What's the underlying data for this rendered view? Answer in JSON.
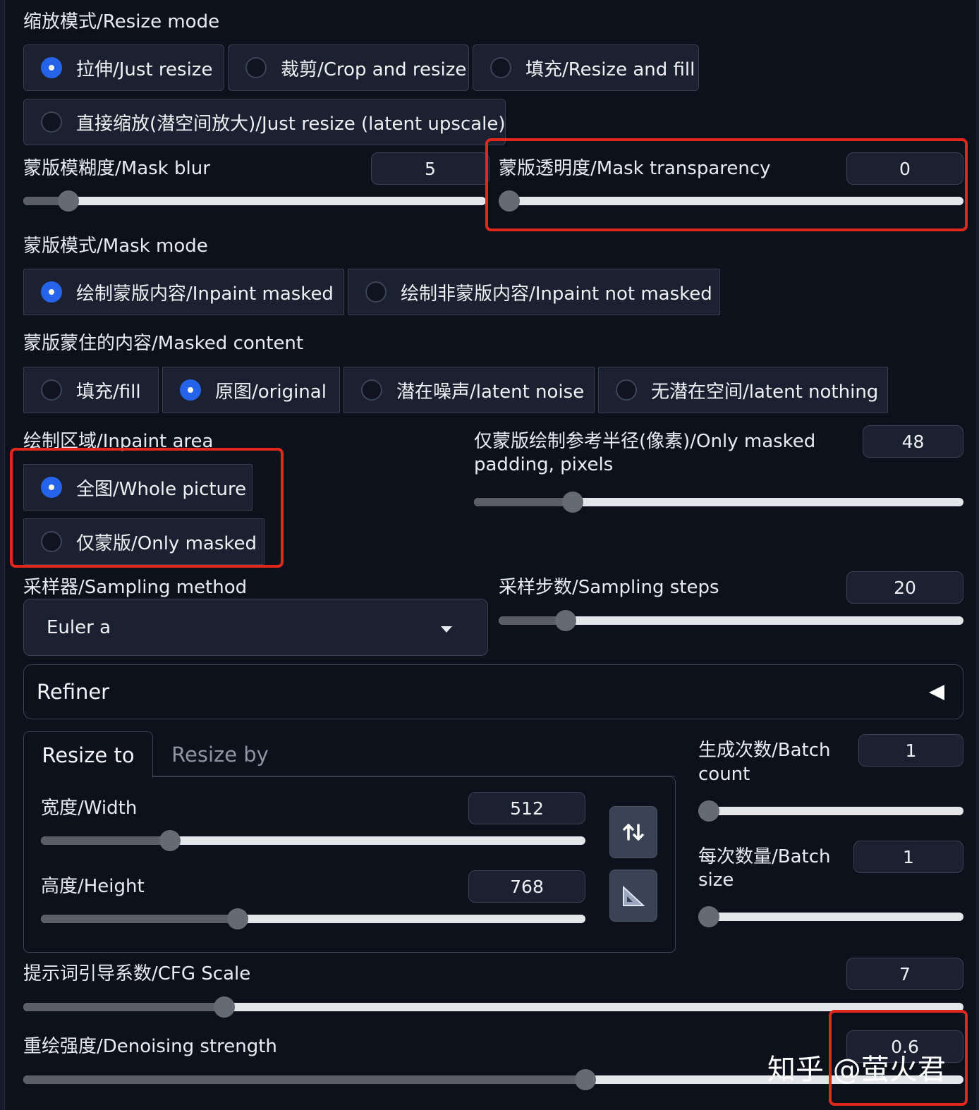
{
  "resize_mode": {
    "label": "缩放模式/Resize mode",
    "options": [
      "拉伸/Just resize",
      "裁剪/Crop and resize",
      "填充/Resize and fill",
      "直接缩放(潜空间放大)/Just resize (latent upscale)"
    ],
    "selected": 0
  },
  "mask_blur": {
    "label": "蒙版模糊度/Mask blur",
    "value": "5"
  },
  "mask_transparency": {
    "label": "蒙版透明度/Mask transparency",
    "value": "0"
  },
  "mask_mode": {
    "label": "蒙版模式/Mask mode",
    "options": [
      "绘制蒙版内容/Inpaint masked",
      "绘制非蒙版内容/Inpaint not masked"
    ],
    "selected": 0
  },
  "masked_content": {
    "label": "蒙版蒙住的内容/Masked content",
    "options": [
      "填充/fill",
      "原图/original",
      "潜在噪声/latent noise",
      "无潜在空间/latent nothing"
    ],
    "selected": 1
  },
  "inpaint_area": {
    "label": "绘制区域/Inpaint area",
    "options": [
      "全图/Whole picture",
      "仅蒙版/Only masked"
    ],
    "selected": 0
  },
  "only_masked_padding": {
    "label_line1": "仅蒙版绘制参考半径(像素)/Only masked",
    "label_line2": "padding, pixels",
    "value": "48"
  },
  "sampling_method": {
    "label": "采样器/Sampling method",
    "value": "Euler a"
  },
  "sampling_steps": {
    "label": "采样步数/Sampling steps",
    "value": "20"
  },
  "refiner": {
    "label": "Refiner"
  },
  "size_tabs": {
    "resize_to": "Resize to",
    "resize_by": "Resize by"
  },
  "width": {
    "label": "宽度/Width",
    "value": "512"
  },
  "height": {
    "label": "高度/Height",
    "value": "768"
  },
  "batch_count": {
    "label_line1": "生成次数/Batch",
    "label_line2": "count",
    "value": "1"
  },
  "batch_size": {
    "label_line1": "每次数量/Batch",
    "label_line2": "size",
    "value": "1"
  },
  "cfg_scale": {
    "label": "提示词引导系数/CFG Scale",
    "value": "7"
  },
  "denoising": {
    "label": "重绘强度/Denoising strength",
    "value": "0.6"
  },
  "watermark": "知乎 @萤火君",
  "icons": {
    "swap": "swap-dimensions-icon",
    "aspect": "aspect-ratio-icon",
    "caret": "dropdown-caret-icon",
    "collapse": "collapse-triangle-icon"
  },
  "colors": {
    "background": "#0d111c",
    "accent": "#2563eb",
    "highlight_box": "#e3271b"
  }
}
